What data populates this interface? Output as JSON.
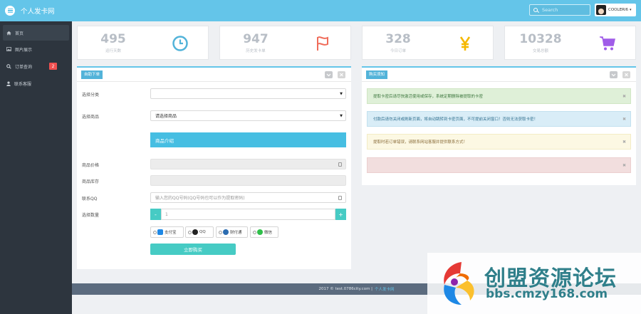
{
  "header": {
    "brand": "个人发卡网",
    "search_placeholder": "Search",
    "username": "COOLERI6"
  },
  "sidebar": {
    "items": [
      {
        "label": "首页",
        "icon": "home-icon"
      },
      {
        "label": "图片展示",
        "icon": "image-icon"
      },
      {
        "label": "订单查询",
        "icon": "search-icon",
        "badge": "2"
      },
      {
        "label": "联系客服",
        "icon": "user-icon"
      }
    ]
  },
  "stats": [
    {
      "value": "495",
      "label": "运行天数",
      "icon": "clock-icon",
      "color": "#52b3d9"
    },
    {
      "value": "947",
      "label": "历史发卡单",
      "icon": "flag-icon",
      "color": "#f06c5a"
    },
    {
      "value": "328",
      "label": "今日订单",
      "icon": "yen-icon",
      "color": "#f5b800"
    },
    {
      "value": "10328",
      "label": "交易总额",
      "icon": "cart-icon",
      "color": "#a05ce8"
    }
  ],
  "order_panel": {
    "title": "自助下单",
    "category_label": "选择分类",
    "category_value": "",
    "product_label": "选择商品",
    "product_value": "请选择商品",
    "summary_bar": "商品介绍",
    "price_label": "商品价格",
    "stock_label": "商品库存",
    "contact_label": "联系QQ",
    "contact_placeholder": "输入您的QQ号码(QQ号码也可以作为提取密码)",
    "quantity_label": "选择数量",
    "quantity_minus": "-",
    "quantity_value": "1",
    "quantity_plus": "+",
    "pay_methods": [
      {
        "label": "支付宝",
        "icon": "alipay-icon",
        "color": "#1e88e5"
      },
      {
        "label": "QQ",
        "icon": "qq-icon",
        "color": "#222222"
      },
      {
        "label": "财付通",
        "icon": "tenpay-icon",
        "color": "#2b6cb0"
      },
      {
        "label": "微信",
        "icon": "wechat-icon",
        "color": "#2fbf4a"
      }
    ],
    "buy_button": "立即购买"
  },
  "notice_panel": {
    "title": "购买须知",
    "notices": [
      {
        "text": "提取卡密后请尽快激活使用或保存，系统定期删除被提取的卡密",
        "bg": "#dff0d8",
        "border": "#d0e6c4",
        "color": "#3c763d"
      },
      {
        "text": "付款后请勿关闭或刷新页面，将自动跳转到卡密页面，不可提前关闭窗口！否则无法获取卡密！",
        "bg": "#d9edf7",
        "border": "#c3e1ef",
        "color": "#31708f"
      },
      {
        "text": "提取时若订单错误，请联系网站客服并提供联系方式！",
        "bg": "#fcf8e3",
        "border": "#f3ecc6",
        "color": "#8a6d3b"
      },
      {
        "text": "",
        "bg": "#f2dede",
        "border": "#ebcfcf",
        "color": "#a94442"
      }
    ]
  },
  "footer": {
    "text": "2017 © test.0786city.com |",
    "link": "个人发卡网"
  },
  "watermark": {
    "title": "创盟资源论坛",
    "url": "bbs.cmzy168.com"
  }
}
